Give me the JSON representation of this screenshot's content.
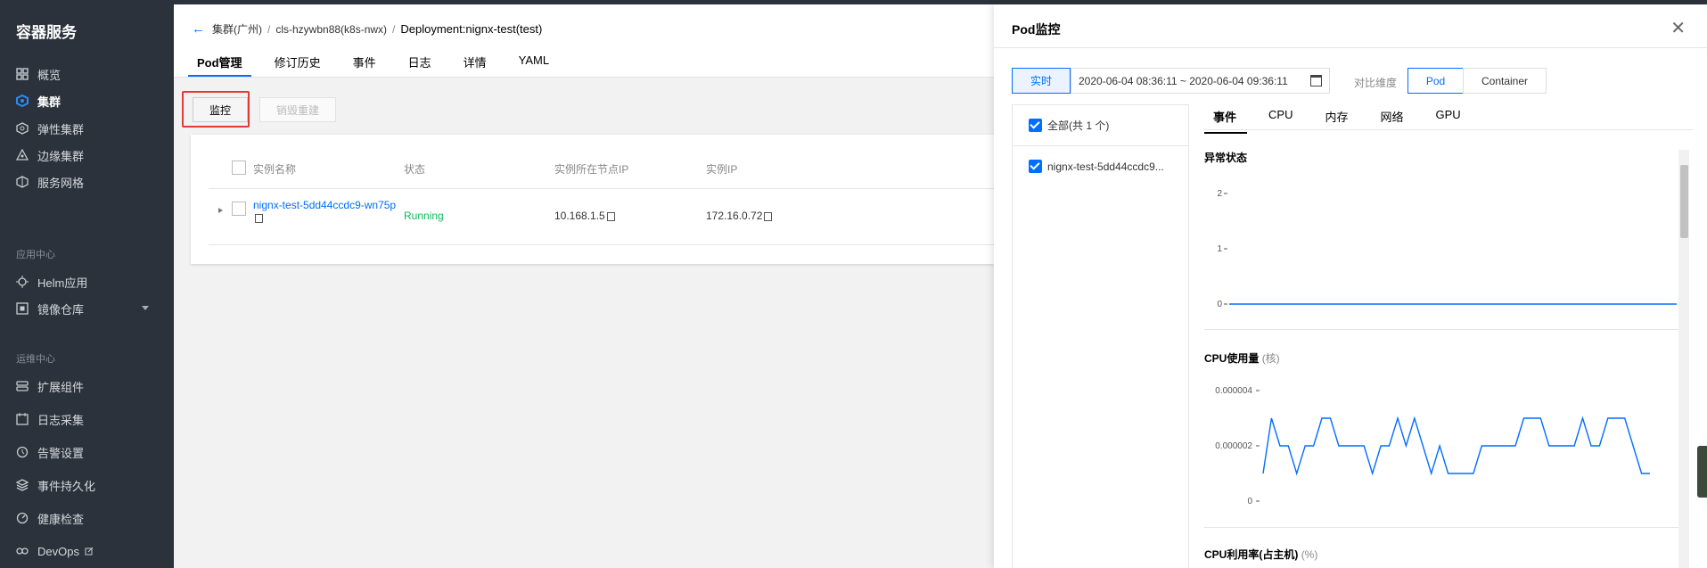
{
  "sidebar": {
    "brand": "容器服务",
    "items": [
      {
        "label": "概览",
        "icon": "grid-icon"
      },
      {
        "label": "集群",
        "icon": "hexagon-icon",
        "active": true
      },
      {
        "label": "弹性集群",
        "icon": "cluster-icon"
      },
      {
        "label": "边缘集群",
        "icon": "edge-icon"
      },
      {
        "label": "服务网格",
        "icon": "mesh-icon"
      }
    ],
    "section_app": "应用中心",
    "app_items": [
      {
        "label": "Helm应用",
        "icon": "helm-icon"
      },
      {
        "label": "镜像仓库",
        "icon": "registry-icon"
      }
    ],
    "section_ops": "运维中心",
    "ops_items": [
      {
        "label": "扩展组件",
        "icon": "extension-icon"
      },
      {
        "label": "日志采集",
        "icon": "log-icon"
      },
      {
        "label": "告警设置",
        "icon": "alarm-icon"
      },
      {
        "label": "事件持久化",
        "icon": "layers-icon"
      },
      {
        "label": "健康检查",
        "icon": "health-icon"
      },
      {
        "label": "DevOps",
        "icon": "devops-icon"
      }
    ]
  },
  "header": {
    "breadcrumb": [
      "集群(广州)",
      "cls-hzywbn88(k8s-nwx)",
      "Deployment:nignx-test(test)"
    ],
    "tabs": [
      "Pod管理",
      "修订历史",
      "事件",
      "日志",
      "详情",
      "YAML"
    ],
    "active_tab": "Pod管理"
  },
  "toolbar": {
    "monitor_label": "监控",
    "rebuild_label": "销毁重建"
  },
  "table": {
    "columns": [
      "实例名称",
      "状态",
      "实例所在节点IP",
      "实例IP"
    ],
    "rows": [
      {
        "name": "nignx-test-5dd44ccdc9-wn75p",
        "status": "Running",
        "node_ip": "10.168.1.5",
        "pod_ip": "172.16.0.72"
      }
    ]
  },
  "drawer": {
    "title": "Pod监控",
    "realtime_label": "实时",
    "time_range": "2020-06-04 08:36:11 ~ 2020-06-04 09:36:11",
    "dimension_label": "对比维度",
    "dimension_options": [
      "Pod",
      "Container"
    ],
    "selected_dimension": "Pod",
    "pod_list": [
      "全部(共 1 个)",
      "nignx-test-5dd44ccdc9..."
    ],
    "metric_tabs": [
      "事件",
      "CPU",
      "内存",
      "网络",
      "GPU"
    ],
    "active_metric_tab": "事件"
  },
  "chart_data": [
    {
      "type": "line",
      "title": "异常状态",
      "yticks": [
        "2",
        "1",
        "0"
      ],
      "ylim": [
        0,
        2
      ],
      "values": [
        0,
        0,
        0,
        0,
        0,
        0,
        0,
        0,
        0,
        0,
        0,
        0,
        0,
        0,
        0,
        0,
        0,
        0,
        0,
        0,
        0,
        0,
        0,
        0,
        0,
        0,
        0,
        0,
        0,
        0,
        0,
        0,
        0,
        0,
        0,
        0,
        0,
        0,
        0,
        0,
        0,
        0,
        0,
        0,
        0,
        0,
        0,
        0,
        0,
        0,
        0,
        0,
        0,
        0,
        0,
        0,
        0,
        0,
        0,
        0
      ],
      "color": "#006eff"
    },
    {
      "type": "line",
      "title": "CPU使用量",
      "unit": "(核)",
      "yticks": [
        "0.000004",
        "0.000002",
        "0"
      ],
      "ylim": [
        0,
        4e-06
      ],
      "values": [
        1e-06,
        3e-06,
        2e-06,
        2e-06,
        1e-06,
        2e-06,
        2e-06,
        3e-06,
        3e-06,
        2e-06,
        2e-06,
        2e-06,
        2e-06,
        1e-06,
        2e-06,
        2e-06,
        3e-06,
        2e-06,
        3e-06,
        2e-06,
        1e-06,
        2e-06,
        1e-06,
        1e-06,
        1e-06,
        1e-06,
        2e-06,
        2e-06,
        2e-06,
        2e-06,
        2e-06,
        3e-06,
        3e-06,
        3e-06,
        2e-06,
        2e-06,
        2e-06,
        2e-06,
        3e-06,
        2e-06,
        2e-06,
        3e-06,
        3e-06,
        3e-06,
        2e-06,
        1e-06,
        1e-06
      ],
      "color": "#006eff"
    },
    {
      "type": "line",
      "title": "CPU利用率(占主机)",
      "unit": "(%)"
    }
  ]
}
